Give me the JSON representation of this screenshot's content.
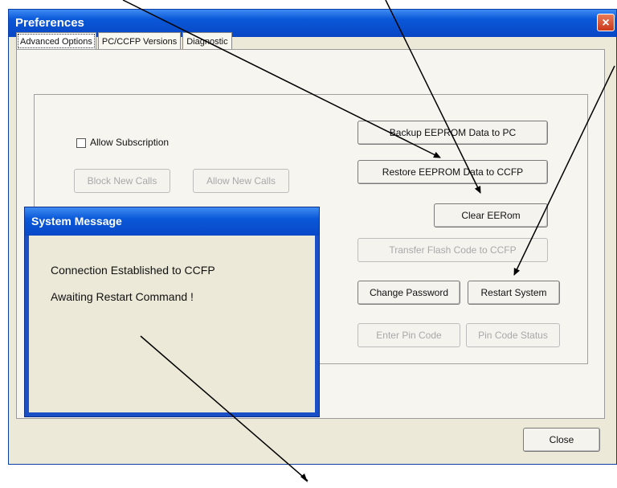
{
  "window": {
    "title": "Preferences",
    "close_icon": "×"
  },
  "tabs": [
    {
      "label": "Advanced Options"
    },
    {
      "label": "PC/CCFP Versions"
    },
    {
      "label": "Diagnostic"
    }
  ],
  "panel": {
    "checkbox_label": "Allow Subscription",
    "block_new_calls": "Block New Calls",
    "allow_new_calls": "Allow New Calls",
    "backup_eeprom": "Backup EEPROM Data to PC",
    "restore_eeprom": "Restore EEPROM Data to CCFP",
    "clear_eeprom": "Clear EERom",
    "transfer_flash": "Transfer Flash Code to CCFP",
    "change_password": "Change Password",
    "restart_system": "Restart System",
    "enter_pin": "Enter Pin Code",
    "pin_status": "Pin Code Status",
    "close": "Close"
  },
  "system_message": {
    "title": "System Message",
    "line1": "Connection Established to CCFP",
    "line2": "Awaiting Restart Command !"
  }
}
